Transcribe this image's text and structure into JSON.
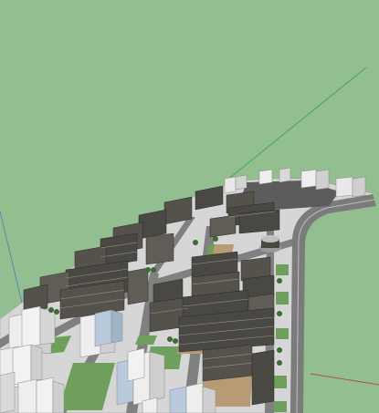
{
  "viewport": {
    "background_color": "#93be8f",
    "ground_color": "#d7d7d7",
    "road_color": "#7d7d7d",
    "lawn_color": "#6f9f5c",
    "plaza_color": "#b69a74",
    "building_dark_color": "#3f3d38",
    "building_mid_color": "#6e6a60",
    "tower_white_color": "#eeeeee",
    "tower_blue_color": "#b8cadb",
    "axis_green_color": "#3fa36a",
    "axis_red_color": "#b25050",
    "axis_blue_color": "#5f86b5"
  }
}
